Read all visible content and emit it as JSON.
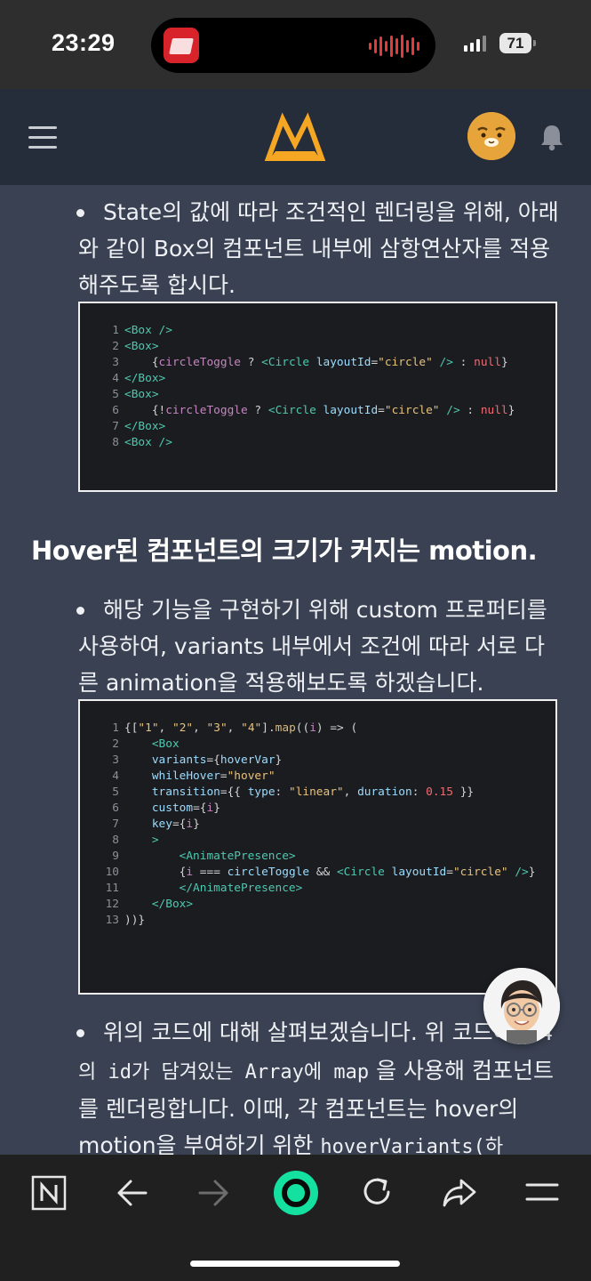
{
  "status_bar": {
    "time": "23:29",
    "battery": "71"
  },
  "content": {
    "bullet1": "State의 값에 따라 조건적인 렌더링을 위해, 아래와 같이 Box의 컴포넌트 내부에 삼항연산자를 적용해주도록 합시다.",
    "heading": "Hover된 컴포넌트의 크기가 커지는 motion.",
    "bullet2": "해당 기능을 구현하기 위해 custom 프로퍼티를 사용하여, variants 내부에서 조건에 따라 서로 다른 animation을 적용해보도록 하겠습니다.",
    "bullet3_a": "위의 코드에 대해 살펴보겠습니다. 위 코드에서 ",
    "bullet3_code1": "4의 id가 담겨있는 Array에 map",
    "bullet3_b": " 을 사용해 컴포넌트를 렌더링합니다. 이때, 각 컴포넌트는 hover의 motion을 부여하기 위한 ",
    "bullet3_code2": "hoverVariants(하"
  },
  "icons": {
    "menu": "hamburger-menu-icon",
    "logo": "site-logo",
    "avatar": "user-avatar",
    "bell": "notification-bell-icon",
    "n": "n-app-icon",
    "back": "back-arrow-icon",
    "forward": "forward-arrow-icon",
    "home": "browser-home-icon",
    "reload": "reload-icon",
    "share": "share-icon",
    "more": "more-menu-icon"
  }
}
